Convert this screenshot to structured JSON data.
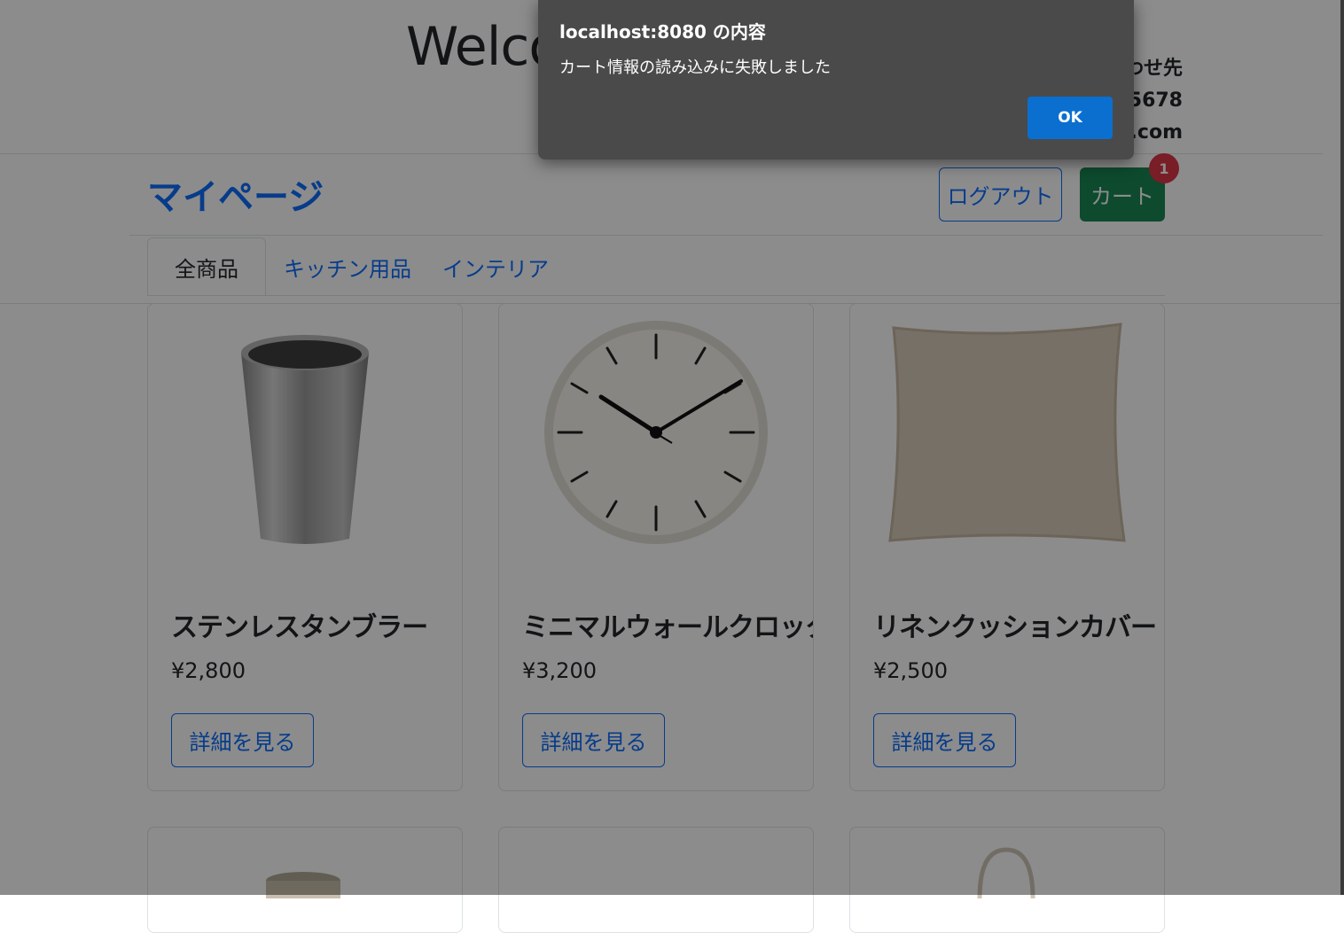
{
  "header": {
    "welcome": "Welco",
    "contact_lines": [
      "わせ先",
      "-5678",
      "e.com"
    ]
  },
  "nav": {
    "mypage_label": "マイページ",
    "logout_label": "ログアウト",
    "cart_label": "カート",
    "cart_count": "1"
  },
  "tabs": [
    {
      "label": "全商品",
      "active": true
    },
    {
      "label": "キッチン用品",
      "active": false
    },
    {
      "label": "インテリア",
      "active": false
    }
  ],
  "products": [
    {
      "name": "ステンレスタンブラー",
      "price": "¥2,800",
      "button": "詳細を見る",
      "image": "tumbler"
    },
    {
      "name": "ミニマルウォールクロック",
      "price": "¥3,200",
      "button": "詳細を見る",
      "image": "wall-clock"
    },
    {
      "name": "リネンクッションカバー",
      "price": "¥2,500",
      "button": "詳細を見る",
      "image": "cushion"
    }
  ],
  "dialog": {
    "title": "localhost:8080 の内容",
    "message": "カート情報の読み込みに失敗しました",
    "ok_label": "OK"
  },
  "colors": {
    "primary": "#0d6efd",
    "success": "#198754",
    "danger": "#dc3545",
    "dialog_bg": "#4a4a4a",
    "dialog_button": "#0b6fcf"
  }
}
